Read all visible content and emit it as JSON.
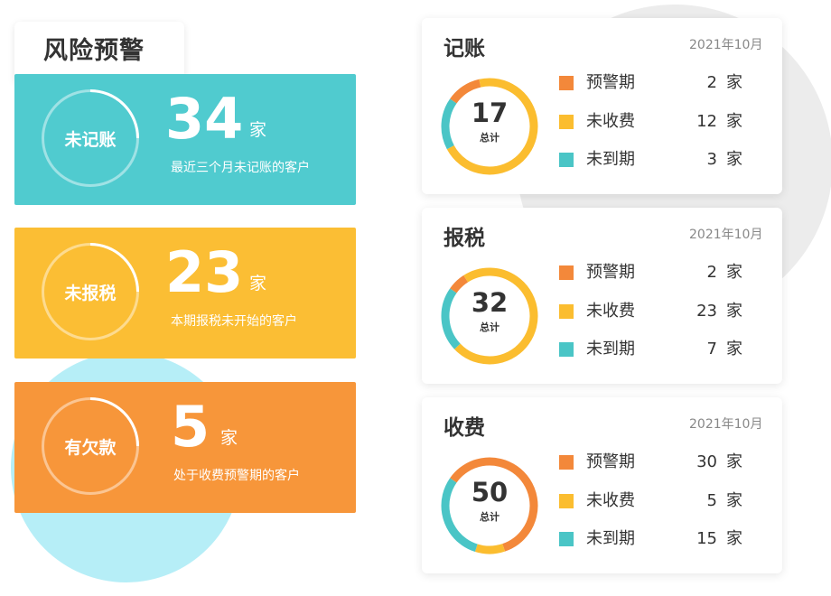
{
  "header": {
    "title": "风险预警"
  },
  "colors": {
    "teal": "#50cbcf",
    "yellow": "#fbbe34",
    "orange": "#f7963a",
    "legend_orange": "#f3883a",
    "legend_yellow": "#fbbd2f",
    "legend_teal": "#4ac5c6"
  },
  "risk_cards": [
    {
      "label": "未记账",
      "count": "34",
      "unit": "家",
      "desc": "最近三个月未记账的客户",
      "color": "#50cbcf"
    },
    {
      "label": "未报税",
      "count": "23",
      "unit": "家",
      "desc": "本期报税未开始的客户",
      "color": "#fbbe34"
    },
    {
      "label": "有欠款",
      "count": "5",
      "unit": "家",
      "desc": "处于收费预警期的客户",
      "color": "#f7963a"
    }
  ],
  "stat_cards": [
    {
      "title": "记账",
      "date": "2021年10月",
      "total": "17",
      "total_label": "总计",
      "items": [
        {
          "name": "预警期",
          "count": "2",
          "unit": "家"
        },
        {
          "name": "未收费",
          "count": "12",
          "unit": "家"
        },
        {
          "name": "未到期",
          "count": "3",
          "unit": "家"
        }
      ]
    },
    {
      "title": "报税",
      "date": "2021年10月",
      "total": "32",
      "total_label": "总计",
      "items": [
        {
          "name": "预警期",
          "count": "2",
          "unit": "家"
        },
        {
          "name": "未收费",
          "count": "23",
          "unit": "家"
        },
        {
          "name": "未到期",
          "count": "7",
          "unit": "家"
        }
      ]
    },
    {
      "title": "收费",
      "date": "2021年10月",
      "total": "50",
      "total_label": "总计",
      "items": [
        {
          "name": "预警期",
          "count": "30",
          "unit": "家"
        },
        {
          "name": "未收费",
          "count": "5",
          "unit": "家"
        },
        {
          "name": "未到期",
          "count": "15",
          "unit": "家"
        }
      ]
    }
  ]
}
